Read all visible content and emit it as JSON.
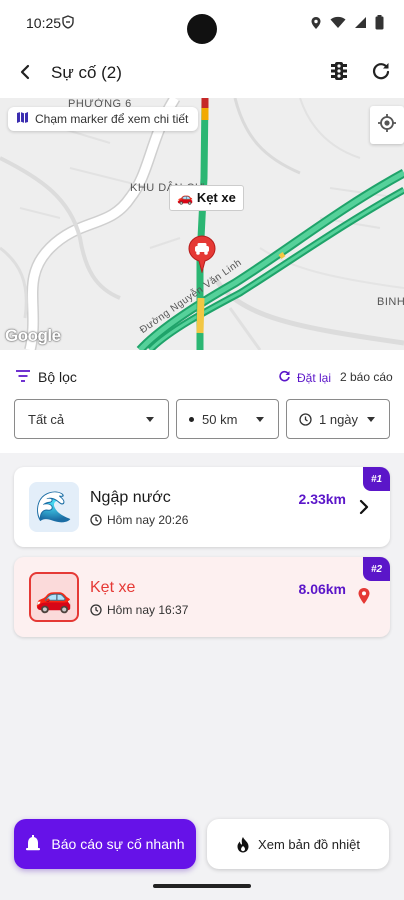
{
  "status_bar": {
    "time": "10:25"
  },
  "app_bar": {
    "title": "Sự cố (2)"
  },
  "map": {
    "hint": "Chạm marker để xem chi tiết",
    "marker_label": "Kẹt xe",
    "marker_emoji": "🚗",
    "labels": {
      "phuong": "PHƯỜNG 6",
      "khu": "KHU DÂN CƯ",
      "binh": "BINH",
      "road": "Đường Nguyễn Văn Linh"
    },
    "attribution": "Google"
  },
  "filters": {
    "title": "Bộ lọc",
    "reset_label": "Đặt lại",
    "report_count": "2 báo cáo",
    "type_value": "Tất cả",
    "radius_value": "50 km",
    "time_value": "1 ngày"
  },
  "incidents": [
    {
      "rank": "#1",
      "name": "Ngập nước",
      "time": "Hôm nay 20:26",
      "distance": "2.33km",
      "emoji": "🌊",
      "icon": "chevron-right-icon"
    },
    {
      "rank": "#2",
      "name": "Kẹt xe",
      "time": "Hôm nay 16:37",
      "distance": "8.06km",
      "emoji": "🚗",
      "icon": "location-pin-icon"
    }
  ],
  "actions": {
    "report_label": "Báo cáo sự cố nhanh",
    "heatmap_label": "Xem bản đồ nhiệt"
  },
  "colors": {
    "primary": "#6612e8",
    "accent_text": "#5b16c9",
    "danger": "#e53935",
    "active_card_bg": "#fdf0f0"
  }
}
